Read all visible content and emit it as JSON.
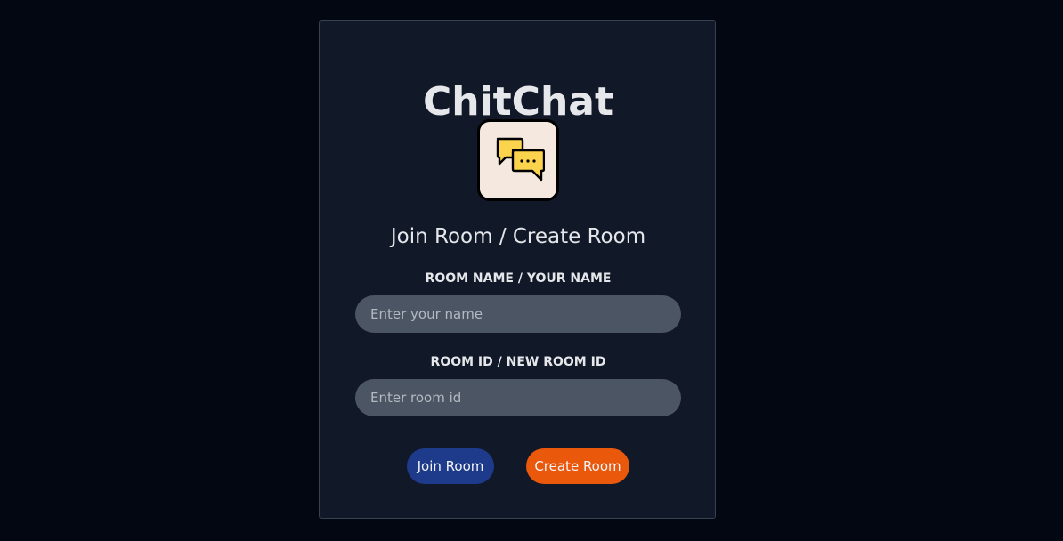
{
  "app": {
    "title": "ChitChat",
    "logo_icon": "chat-bubbles-icon"
  },
  "form": {
    "heading": "Join Room / Create Room",
    "name_label": "ROOM NAME / YOUR NAME",
    "name_placeholder": "Enter your name",
    "name_value": "",
    "room_label": "ROOM ID / NEW ROOM ID",
    "room_placeholder": "Enter room id",
    "room_value": ""
  },
  "actions": {
    "join_label": "Join Room",
    "create_label": "Create Room"
  },
  "colors": {
    "page_background": "#030712",
    "card_background": "#111827",
    "input_background": "#4b5563",
    "join_button": "#1e3a8a",
    "create_button": "#ea580c",
    "logo_background": "#f5e9df",
    "bubble_fill": "#fcd34d"
  }
}
